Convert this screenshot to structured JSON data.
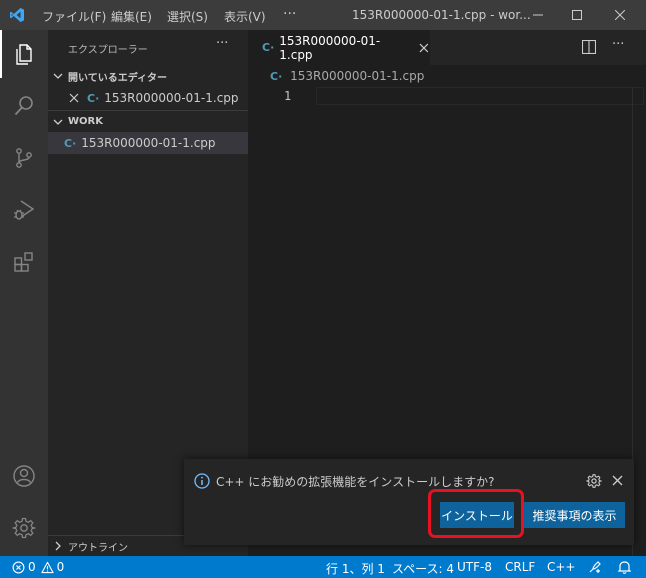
{
  "titlebar": {
    "menu": [
      "ファイル(F)",
      "編集(E)",
      "選択(S)",
      "表示(V)"
    ],
    "more": "···",
    "title": "153R000000-01-1.cpp - wor...",
    "icons": [
      "vscode-logo-icon",
      "minimize-icon",
      "maximize-icon",
      "close-icon"
    ]
  },
  "activitybar": {
    "icons": [
      "files-icon",
      "search-icon",
      "source-control-icon",
      "run-debug-icon",
      "extensions-icon",
      "account-icon",
      "settings-gear-icon"
    ]
  },
  "sidebar": {
    "title": "エクスプローラー",
    "more": "···",
    "open_editors": {
      "header": "開いているエディター",
      "items": [
        {
          "icon": "C·",
          "label": "153R000000-01-1.cpp"
        }
      ]
    },
    "workspace": {
      "header": "WORK",
      "items": [
        {
          "icon": "C·",
          "label": "153R000000-01-1.cpp"
        }
      ]
    },
    "outline": "アウトライン"
  },
  "editor": {
    "tab": {
      "icon": "C·",
      "label": "153R000000-01-1.cpp"
    },
    "breadcrumb": {
      "icon": "C·",
      "label": "153R000000-01-1.cpp"
    },
    "line_numbers": [
      "1"
    ]
  },
  "notification": {
    "message": "C++ にお勧めの拡張機能をインストールしますか?",
    "install_button": "インストール",
    "recommend_button": "推奨事項の表示"
  },
  "statusbar": {
    "errors": "0",
    "warnings": "0",
    "position": "行 1、列 1",
    "spaces": "スペース: 4",
    "encoding": "UTF-8",
    "eol": "CRLF",
    "language": "C++"
  },
  "colors": {
    "accent": "#007acc",
    "button": "#0e639c",
    "highlight_ring": "#e81123",
    "cpp_icon": "#519aba"
  }
}
